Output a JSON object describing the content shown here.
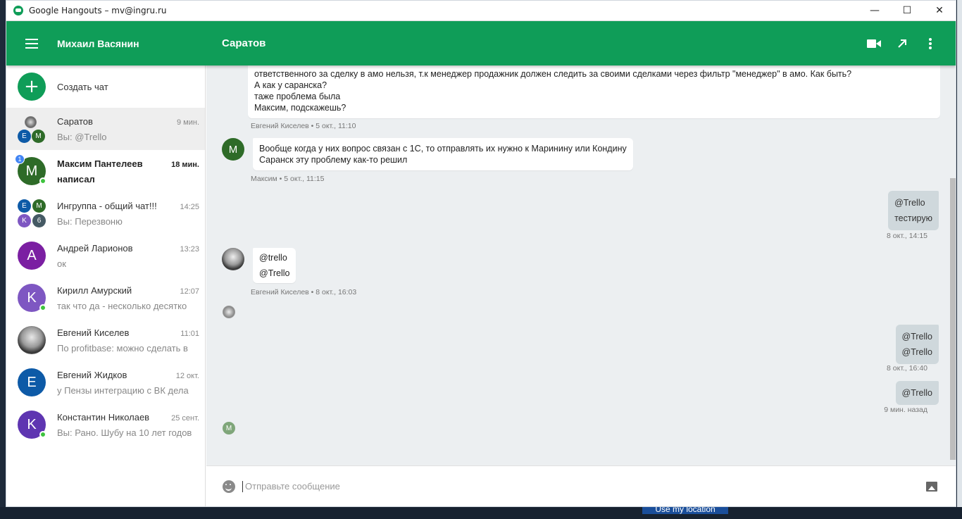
{
  "window": {
    "title": "Google Hangouts – mv@ingru.ru"
  },
  "header": {
    "user_name": "Михаил Васянин",
    "conversation_title": "Саратов"
  },
  "sidebar": {
    "new_chat_label": "Создать чат",
    "conversations": [
      {
        "name": "Саратов",
        "time": "9 мин.",
        "last": "Вы: @Trello",
        "active": true
      },
      {
        "name": "Максим Пантелеев",
        "time": "18 мин.",
        "last": "написал",
        "unread_count": "1",
        "avatar_letter": "M",
        "avatar_color": "#2e6b28"
      },
      {
        "name": "Ингруппа - общий чат!!!",
        "time": "14:25",
        "last": "Вы: Перезвоню",
        "group": [
          "E",
          "M",
          "K",
          "6"
        ]
      },
      {
        "name": "Андрей Ларионов",
        "time": "13:23",
        "last": "ок",
        "avatar_letter": "A",
        "avatar_color": "#7b1fa2"
      },
      {
        "name": "Кирилл Амурский",
        "time": "12:07",
        "last": "так что да - несколько десятко",
        "avatar_letter": "K",
        "avatar_color": "#7e57c2"
      },
      {
        "name": "Евгений Киселев",
        "time": "11:01",
        "last": "По profitbase: можно сделать в"
      },
      {
        "name": "Евгений Жидков",
        "time": "12 окт.",
        "last": "у Пензы интеграцию с ВК дела",
        "avatar_letter": "E",
        "avatar_color": "#0d5aa7"
      },
      {
        "name": "Константин Николаев",
        "time": "25 сент.",
        "last": "Вы: Рано. Шубу на 10 лет годов",
        "avatar_letter": "K",
        "avatar_color": "#5e35b1"
      }
    ]
  },
  "chat": {
    "messages": [
      {
        "lines": [
          "ответственного за сделку в амо нельзя, т.к менеджер продажник должен следить за своими сделками через фильтр \"менеджер\" в амо. Как быть?",
          "А как у саранска?",
          "таже проблема была",
          "Максим, подскажешь?"
        ],
        "meta": "Евгений Киселев • 5 окт., 11:10"
      },
      {
        "lines": [
          "Вообще когда у них вопрос связан с 1С, то отправлять их нужно к Маринину или Кондину",
          "Саранск эту проблему как-то решил"
        ],
        "meta": "Максим • 5 окт., 11:15",
        "avatar_letter": "M"
      },
      {
        "lines": [
          "@Trello",
          "тестирую"
        ],
        "meta": "8 окт., 14:15"
      },
      {
        "lines": [
          "@trello",
          "@Trello"
        ],
        "meta": "Евгений Киселев • 8 окт., 16:03"
      },
      {
        "lines": [
          "@Trello",
          "@Trello"
        ],
        "meta": "8 окт., 16:40"
      },
      {
        "lines": [
          "@Trello"
        ],
        "meta": "9 мин. назад"
      }
    ],
    "read_marker_letter": "M"
  },
  "composer": {
    "placeholder": "Отправьте сообщение"
  },
  "background": {
    "location_button": "Use my location"
  },
  "colors": {
    "accent": "#0f9d58",
    "chat_bg": "#eceff1",
    "outgoing_bubble": "#cfd8dc"
  }
}
